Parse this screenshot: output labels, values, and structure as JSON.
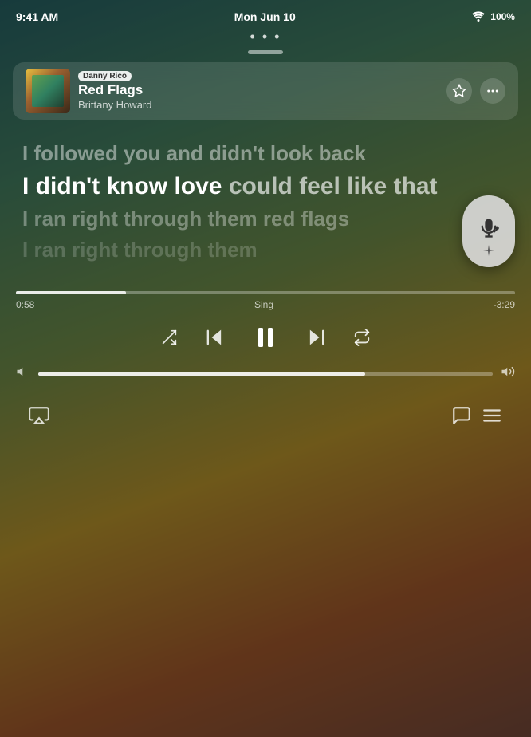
{
  "statusBar": {
    "time": "9:41 AM",
    "date": "Mon Jun 10",
    "wifi": "WiFi",
    "battery": "100%"
  },
  "nowPlaying": {
    "user": "Danny Rico",
    "title": "Red Flags",
    "artist": "Brittany Howard",
    "albumAlt": "Red Flags album art"
  },
  "cardActions": {
    "star": "★",
    "more": "•••"
  },
  "lyrics": {
    "past1": "I followed you and didn't look back",
    "current": "I didn't know love could feel like that",
    "currentHighlight": "I didn't know love ",
    "currentUnhighlight": "could feel like that",
    "future1": "I ran right through them red flags",
    "future2": "I ran right through them"
  },
  "progress": {
    "current": "0:58",
    "label": "Sing",
    "remaining": "-3:29",
    "fillPercent": 22
  },
  "controls": {
    "shuffle": "⇄",
    "prev": "⏮",
    "pause": "⏸",
    "next": "⏭",
    "repeat": "↺"
  },
  "volume": {
    "low": "🔈",
    "high": "🔊",
    "fillPercent": 72
  },
  "bottomToolbar": {
    "airplay": "⊕",
    "lyrics": "💬",
    "queue": "≡"
  },
  "mic": {
    "label": "✦🎤"
  },
  "topDots": "• • •"
}
